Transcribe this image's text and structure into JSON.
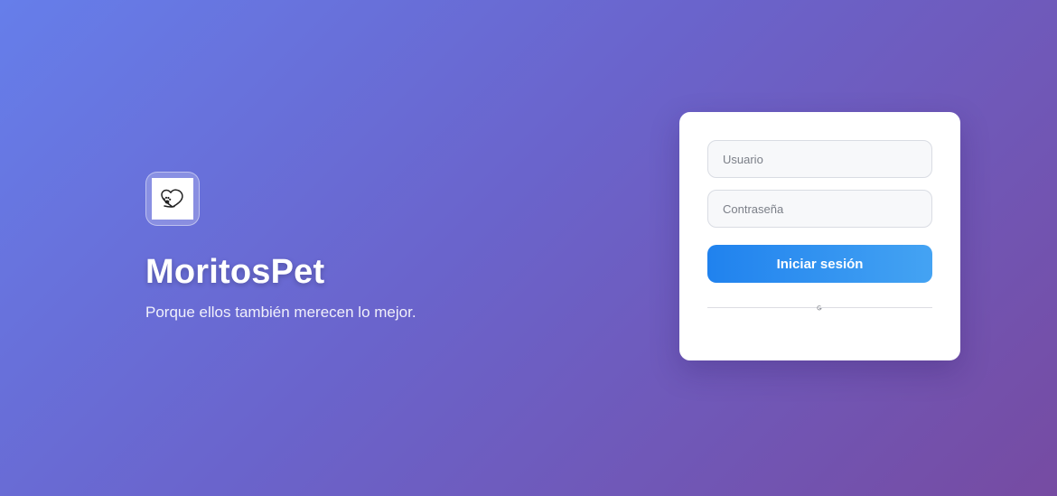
{
  "brand": {
    "logo_icon": "heart-paw-icon",
    "title": "MoritosPet",
    "tagline": "Porque ellos también merecen lo mejor."
  },
  "login": {
    "username_placeholder": "Usuario",
    "password_placeholder": "Contraseña",
    "submit_label": "Iniciar sesión",
    "divider_icon": "google-icon-broken"
  },
  "colors": {
    "background_start": "#667eea",
    "background_end": "#764ba2",
    "button_start": "#2082ee",
    "button_end": "#44a3f3",
    "card": "#ffffff"
  }
}
